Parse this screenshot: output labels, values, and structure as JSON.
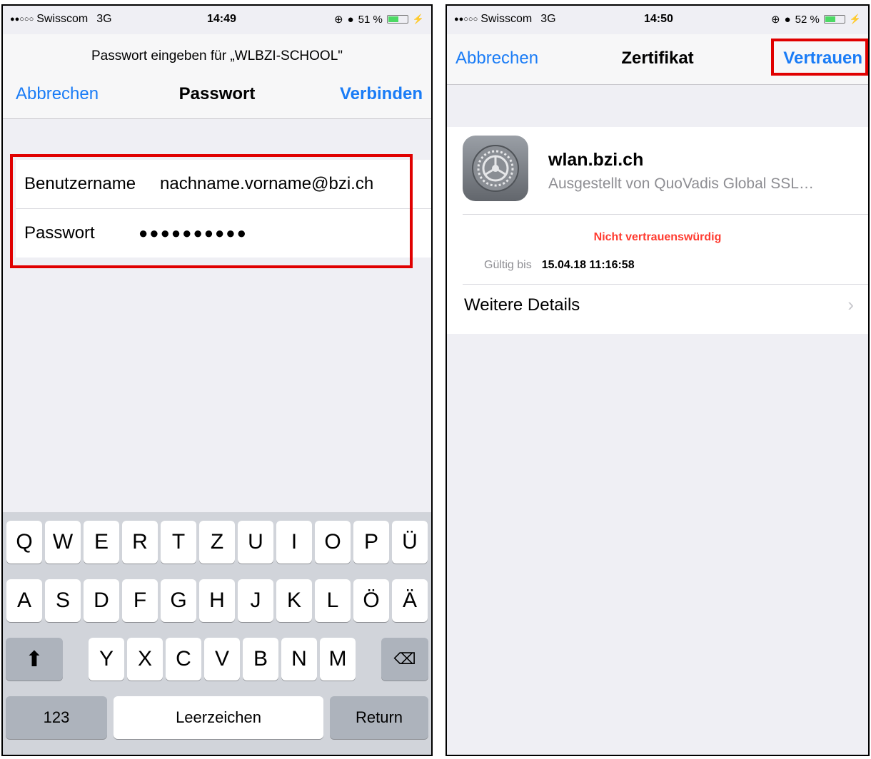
{
  "left": {
    "status": {
      "carrier": "Swisscom",
      "network": "3G",
      "time": "14:49",
      "battery": "51 %"
    },
    "prompt": "Passwort eingeben für „WLBZI-SCHOOL\"",
    "nav": {
      "cancel": "Abbrechen",
      "title": "Passwort",
      "connect": "Verbinden"
    },
    "form": {
      "username_label": "Benutzername",
      "username_value": "nachname.vorname@bzi.ch",
      "password_label": "Passwort",
      "password_value": "●●●●●●●●●●"
    },
    "keyboard": {
      "row1": [
        "Q",
        "W",
        "E",
        "R",
        "T",
        "Z",
        "U",
        "I",
        "O",
        "P",
        "Ü"
      ],
      "row2": [
        "A",
        "S",
        "D",
        "F",
        "G",
        "H",
        "J",
        "K",
        "L",
        "Ö",
        "Ä"
      ],
      "row3": [
        "Y",
        "X",
        "C",
        "V",
        "B",
        "N",
        "M"
      ],
      "numbers": "123",
      "space": "Leerzeichen",
      "return": "Return"
    }
  },
  "right": {
    "status": {
      "carrier": "Swisscom",
      "network": "3G",
      "time": "14:50",
      "battery": "52 %"
    },
    "nav": {
      "cancel": "Abbrechen",
      "title": "Zertifikat",
      "trust": "Vertrauen"
    },
    "cert": {
      "name": "wlan.bzi.ch",
      "issuer": "Ausgestellt von QuoVadis Global SSL…",
      "status": "Nicht vertrauenswürdig",
      "valid_label": "Gültig bis",
      "valid_value": "15.04.18 11:16:58",
      "more": "Weitere Details"
    }
  },
  "colors": {
    "accent": "#1a7cf6",
    "highlight": "#e00000",
    "danger": "#ff3b30"
  }
}
